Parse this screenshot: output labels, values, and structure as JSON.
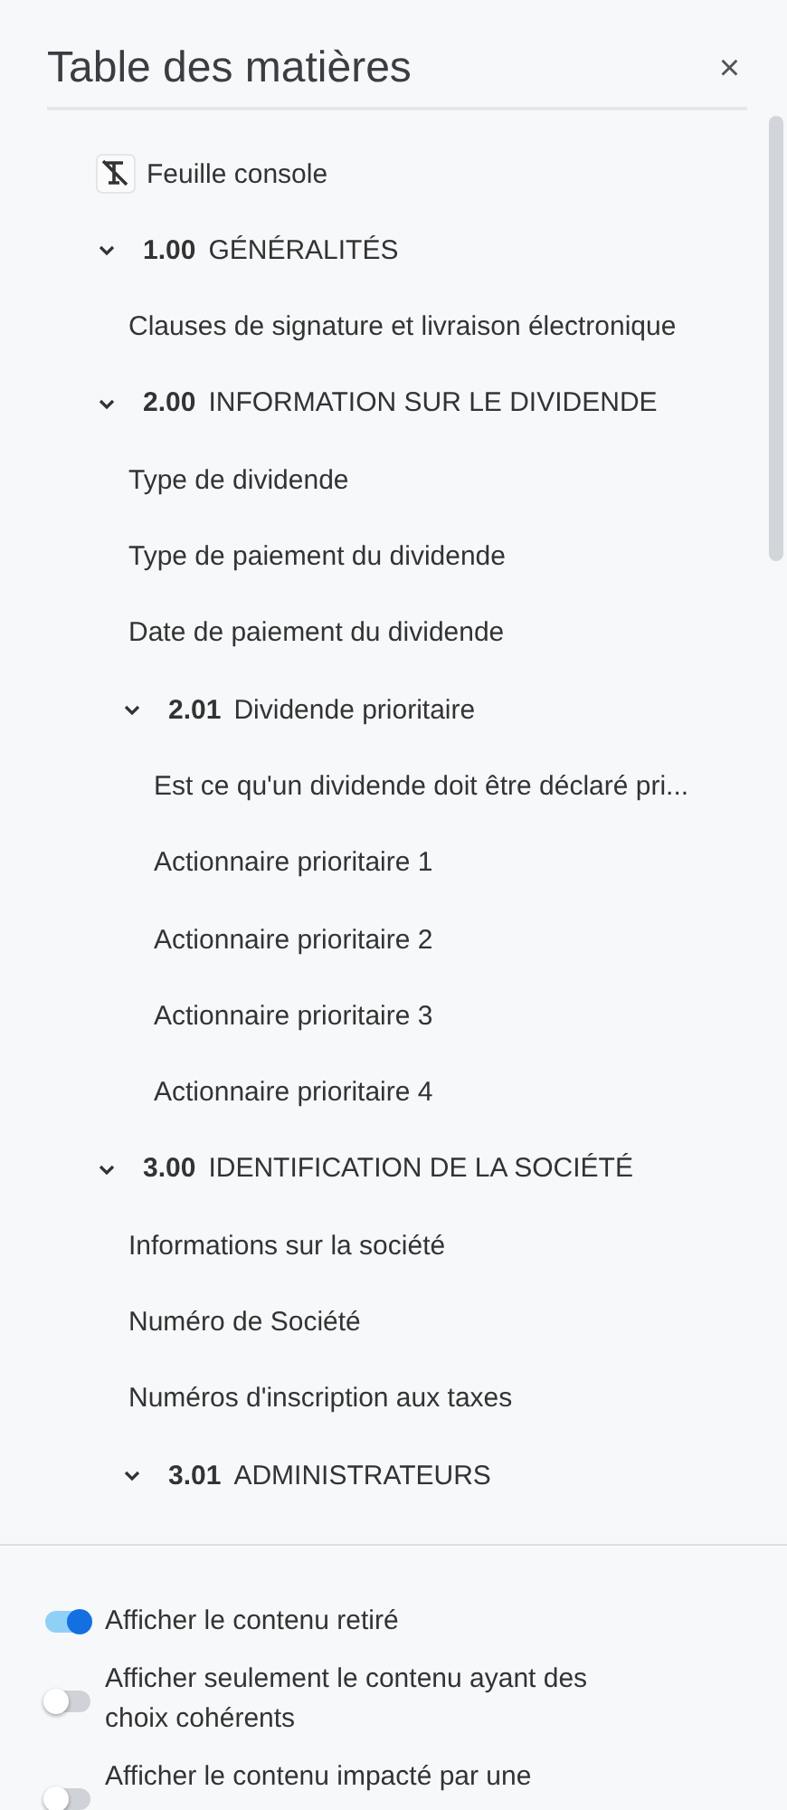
{
  "panel": {
    "title": "Table des matières",
    "close": "×"
  },
  "toc": [
    {
      "kind": "sheet",
      "label": "Feuille console"
    },
    {
      "kind": "section",
      "number": "1.00",
      "title": "GÉNÉRALITÉS",
      "expanded": true,
      "children": [
        {
          "kind": "item",
          "label": "Clauses de signature et livraison électronique"
        }
      ]
    },
    {
      "kind": "section",
      "number": "2.00",
      "title": "INFORMATION SUR LE DIVIDENDE",
      "expanded": true,
      "children": [
        {
          "kind": "item",
          "label": "Type de dividende"
        },
        {
          "kind": "item",
          "label": "Type de paiement du dividende"
        },
        {
          "kind": "item",
          "label": "Date de paiement du dividende"
        },
        {
          "kind": "section",
          "number": "2.01",
          "title": "Dividende prioritaire",
          "expanded": true,
          "children": [
            {
              "kind": "item",
              "label": "Est ce qu'un dividende doit être déclaré pri..."
            },
            {
              "kind": "item",
              "label": "Actionnaire prioritaire 1"
            },
            {
              "kind": "item",
              "label": "Actionnaire prioritaire 2"
            },
            {
              "kind": "item",
              "label": "Actionnaire prioritaire 3"
            },
            {
              "kind": "item",
              "label": "Actionnaire prioritaire 4"
            }
          ]
        }
      ]
    },
    {
      "kind": "section",
      "number": "3.00",
      "title": "IDENTIFICATION DE LA SOCIÉTÉ",
      "expanded": true,
      "children": [
        {
          "kind": "item",
          "label": "Informations sur la société"
        },
        {
          "kind": "item",
          "label": "Numéro de Société"
        },
        {
          "kind": "item",
          "label": "Numéros d'inscription aux taxes"
        },
        {
          "kind": "section",
          "number": "3.01",
          "title": "ADMINISTRATEURS",
          "expanded": true
        }
      ]
    }
  ],
  "options": [
    {
      "label": "Afficher le contenu retiré",
      "on": true
    },
    {
      "label": "Afficher seulement le contenu ayant des choix cohérents",
      "on": false
    },
    {
      "label": "Afficher le contenu impacté par une",
      "on": false
    }
  ]
}
